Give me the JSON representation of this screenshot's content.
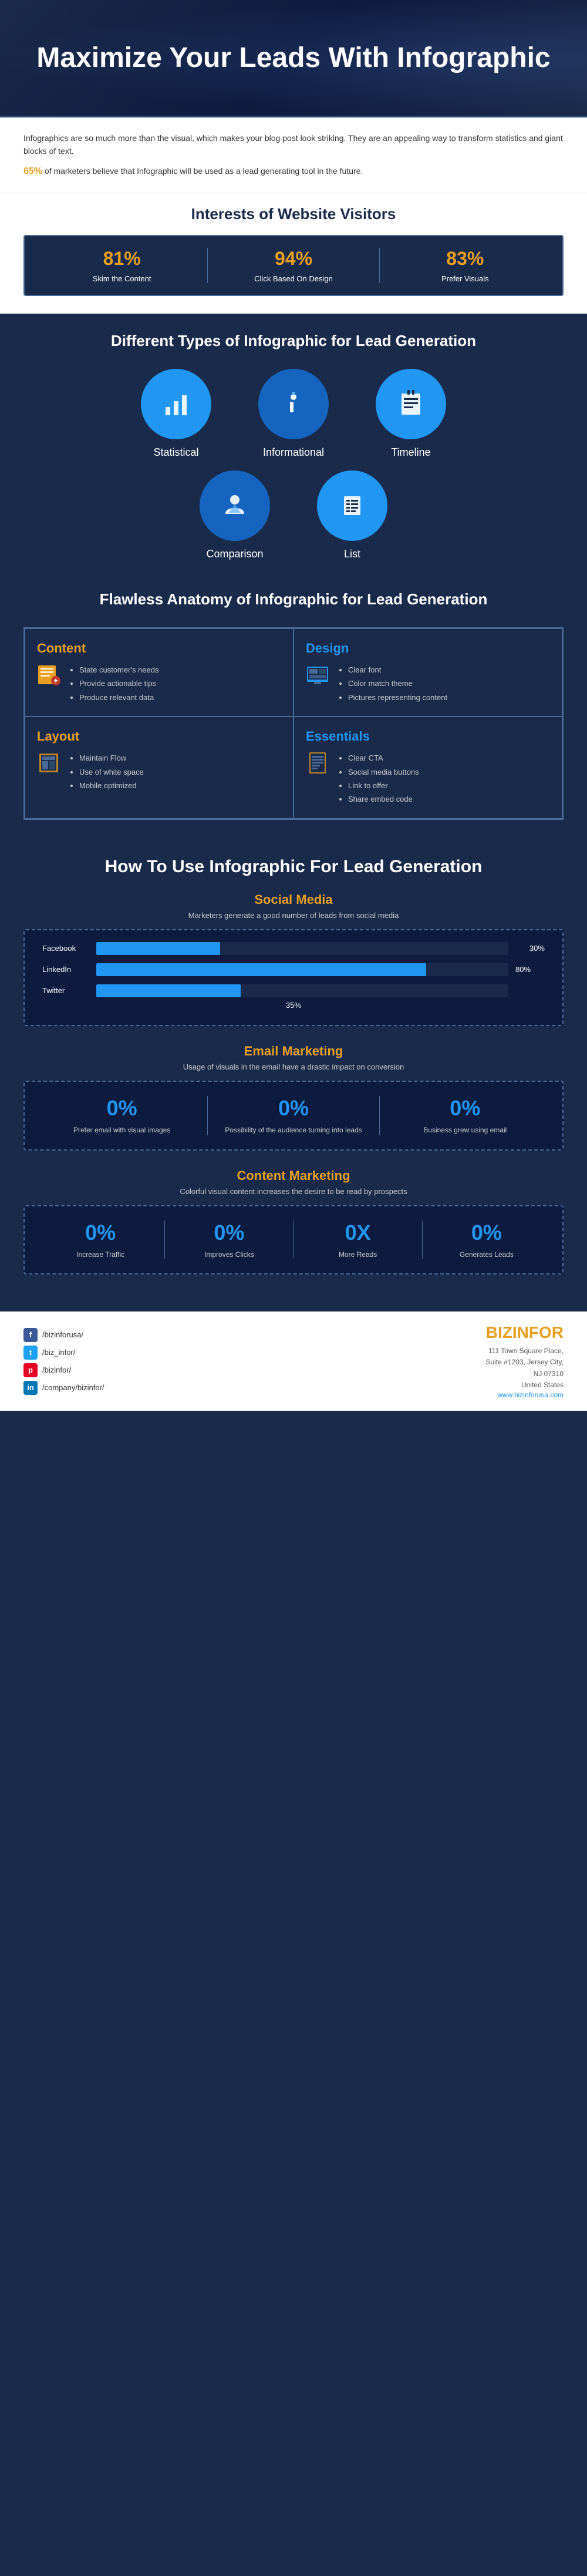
{
  "header": {
    "title": "Maximize Your Leads With Infographic"
  },
  "intro": {
    "text1": "Infographics are so much more than the visual, which makes your blog post look striking. They are an appealing way to transform statistics and giant blocks of text.",
    "highlight_pct": "65%",
    "text2": " of marketers believe that Infographic will be used as a lead generating tool in the future."
  },
  "interests": {
    "title": "Interests of Website Visitors",
    "items": [
      {
        "pct": "81%",
        "label": "Skim the Content"
      },
      {
        "pct": "94%",
        "label": "Click Based On Design"
      },
      {
        "pct": "83%",
        "label": "Prefer Visuals"
      }
    ]
  },
  "types": {
    "title": "Different Types of Infographic for Lead Generation",
    "row1": [
      {
        "label": "Statistical",
        "icon": "🔵"
      },
      {
        "label": "Informational",
        "icon": "ℹ️"
      },
      {
        "label": "Timeline",
        "icon": "📋"
      }
    ],
    "row2": [
      {
        "label": "Comparison",
        "icon": "👤"
      },
      {
        "label": "List",
        "icon": "📝"
      }
    ]
  },
  "anatomy": {
    "title": "Flawless Anatomy of Infographic for Lead Generation",
    "cells": [
      {
        "title": "Content",
        "color": "content-color",
        "icon": "📅",
        "items": [
          "State customer's needs",
          "Provide actionable tips",
          "Produce relevant data"
        ]
      },
      {
        "title": "Design",
        "color": "design-color",
        "icon": "🖥️",
        "items": [
          "Clear font",
          "Color match theme",
          "Pictures representing content"
        ]
      },
      {
        "title": "Layout",
        "color": "layout-color",
        "icon": "📄",
        "items": [
          "Maintain Flow",
          "Use of white space",
          "Mobile optimized"
        ]
      },
      {
        "title": "Essentials",
        "color": "essentials-color",
        "icon": "📑",
        "items": [
          "Clear CTA",
          "Social media buttons",
          "Link to offer",
          "Share embed code"
        ]
      }
    ]
  },
  "howto": {
    "title": "How To Use Infographic For Lead Generation",
    "social_media": {
      "title": "Social Media",
      "subtitle": "Marketers generate a good number of leads from social media",
      "bars": [
        {
          "label": "Facebook",
          "value": "30%",
          "pct": 30
        },
        {
          "label": "LinkedIn",
          "value": "80%",
          "pct": 80
        },
        {
          "label": "Twitter",
          "value": "35%",
          "pct": 35
        }
      ]
    },
    "email_marketing": {
      "title": "Email Marketing",
      "subtitle": "Usage of visuals in the email have a drastic impact on conversion",
      "stats": [
        {
          "value": "0%",
          "label": "Prefer email with visual images"
        },
        {
          "value": "0%",
          "label": "Possibility of the audience turning into leads"
        },
        {
          "value": "0%",
          "label": "Business grew using email"
        }
      ]
    },
    "content_marketing": {
      "title": "Content Marketing",
      "subtitle": "Colorful visual content increases the desire to be read by prospects",
      "stats": [
        {
          "value": "0%",
          "label": "Increase Traffic"
        },
        {
          "value": "0%",
          "label": "Improves Clicks"
        },
        {
          "value": "0X",
          "label": "More Reads"
        },
        {
          "value": "0%",
          "label": "Generates Leads"
        }
      ]
    }
  },
  "footer": {
    "social_links": [
      {
        "platform": "facebook",
        "url": "/bizinforusa/",
        "icon": "f",
        "color": "fb-icon"
      },
      {
        "platform": "twitter",
        "url": "/biz_infor/",
        "icon": "t",
        "color": "tw-icon"
      },
      {
        "platform": "pinterest",
        "url": "/bizinfor/",
        "icon": "p",
        "color": "pin-icon"
      },
      {
        "platform": "linkedin",
        "url": "/company/bizinfor/",
        "icon": "in",
        "color": "li-icon"
      }
    ],
    "company": {
      "name_part1": "BIZIN",
      "name_part2": "FOR",
      "address": "111 Town Square Place,\nSuite #1203, Jersey City,\nNJ 07310\nUnited States",
      "website": "www.bizinforusa.com"
    }
  }
}
